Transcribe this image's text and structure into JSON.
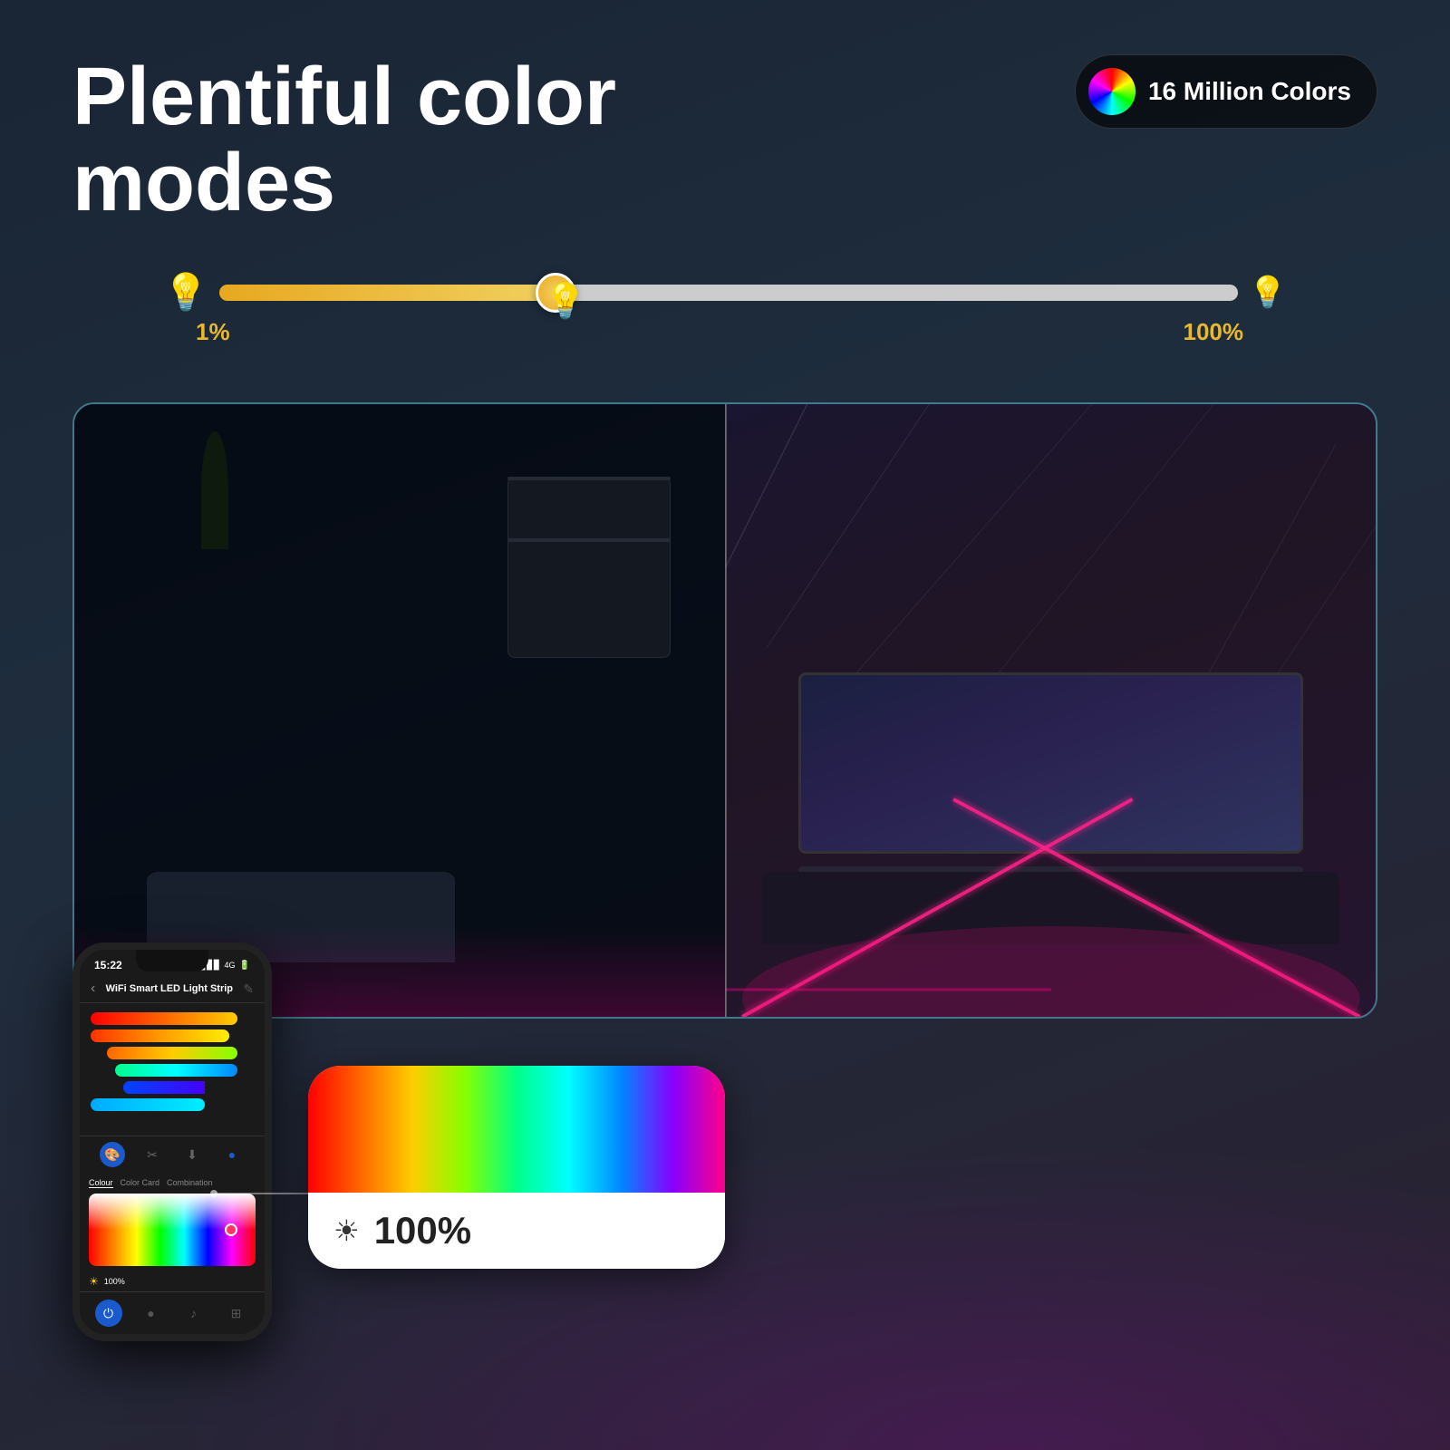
{
  "header": {
    "title": "Plentiful color modes",
    "badge": {
      "text": "16 Million Colors"
    }
  },
  "slider": {
    "label_left": "1%",
    "label_right": "100%"
  },
  "phone": {
    "status": {
      "time": "15:22",
      "signal": "4G"
    },
    "title": "WiFi Smart LED Light Strip",
    "tabs": [
      "Colour",
      "Color Card",
      "Combination"
    ],
    "brightness": "100%"
  },
  "color_card": {
    "brightness_text": "100%"
  }
}
